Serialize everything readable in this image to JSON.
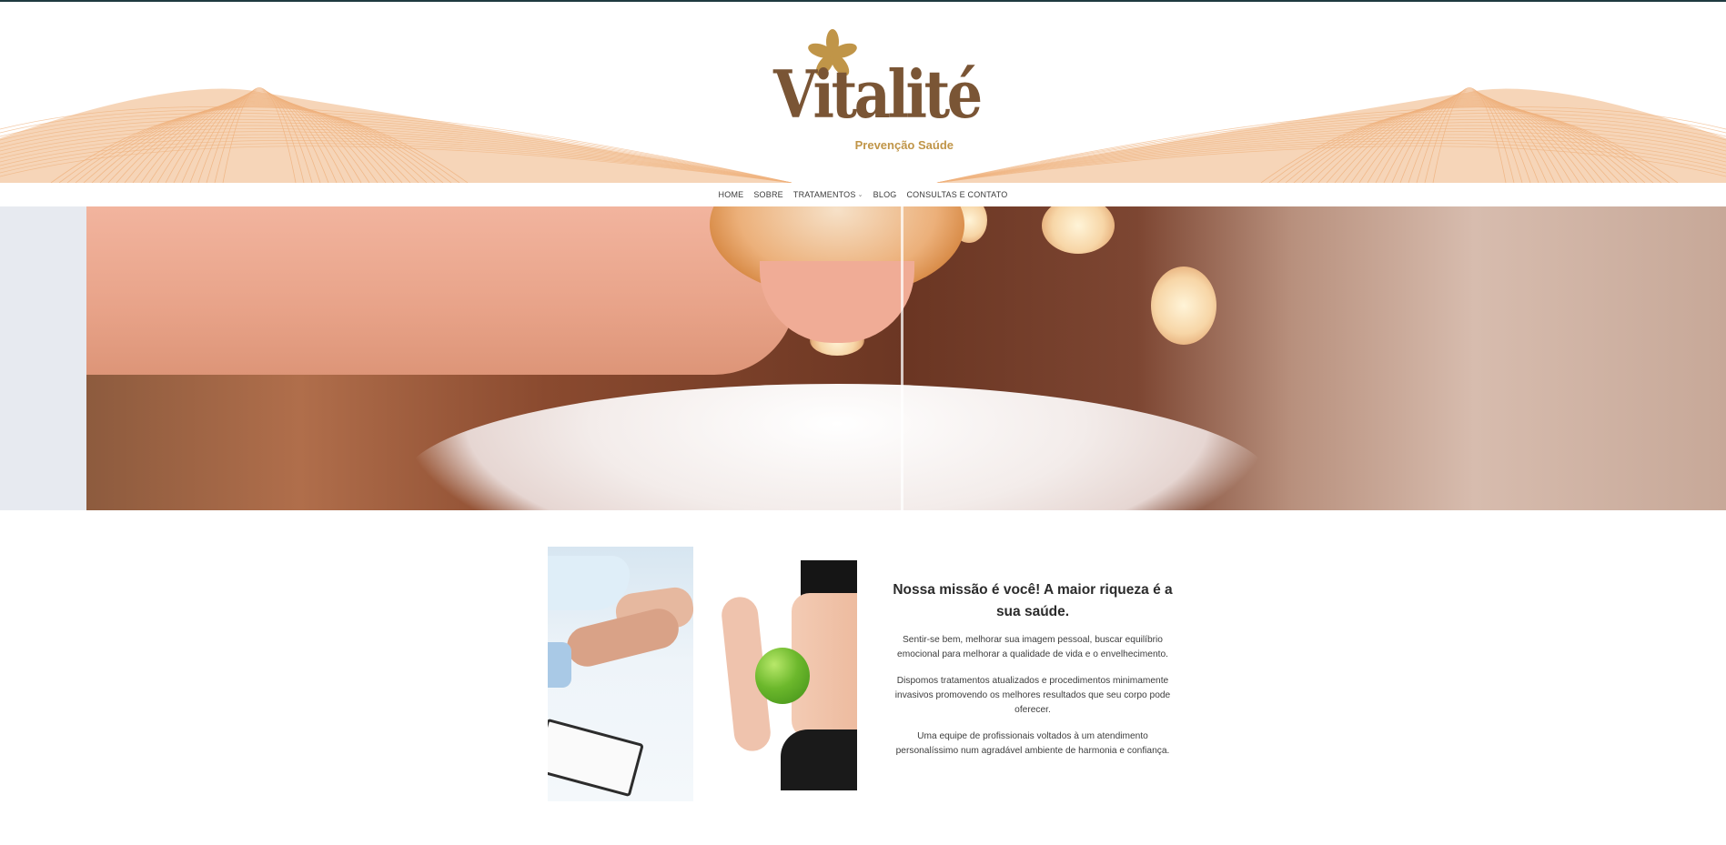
{
  "brand": {
    "name": "Vitalité",
    "tagline": "Prevenção Saúde",
    "primary_color": "#7a5535",
    "accent_color": "#c09548",
    "wave_color": "#efb27e"
  },
  "nav": {
    "items": [
      {
        "label": "HOME",
        "has_dropdown": false
      },
      {
        "label": "SOBRE",
        "has_dropdown": false
      },
      {
        "label": "TRATAMENTOS",
        "has_dropdown": true
      },
      {
        "label": "BLOG",
        "has_dropdown": false
      },
      {
        "label": "CONSULTAS E CONTATO",
        "has_dropdown": false
      }
    ],
    "dropdown_icon": "chevron-down-icon"
  },
  "hero": {
    "image_subject": "massage oil poured over towel"
  },
  "mission": {
    "heading": "Nossa missão é você! A maior riqueza é a sua saúde.",
    "paragraphs": [
      "Sentir-se bem, melhorar sua imagem pessoal, buscar equilíbrio emocional para melhorar a qualidade de vida e o envelhecimento.",
      "Dispomos tratamentos atualizados e procedimentos minimamente invasivos promovendo os melhores resultados que seu corpo pode oferecer.",
      "Uma equipe de profissionais voltados à um atendimento personalíssimo num agradável ambiente de harmonia e confiança."
    ]
  },
  "photos": [
    {
      "subject": "doctor holding patient's hand"
    },
    {
      "subject": "woman holding green apple at waist"
    }
  ]
}
